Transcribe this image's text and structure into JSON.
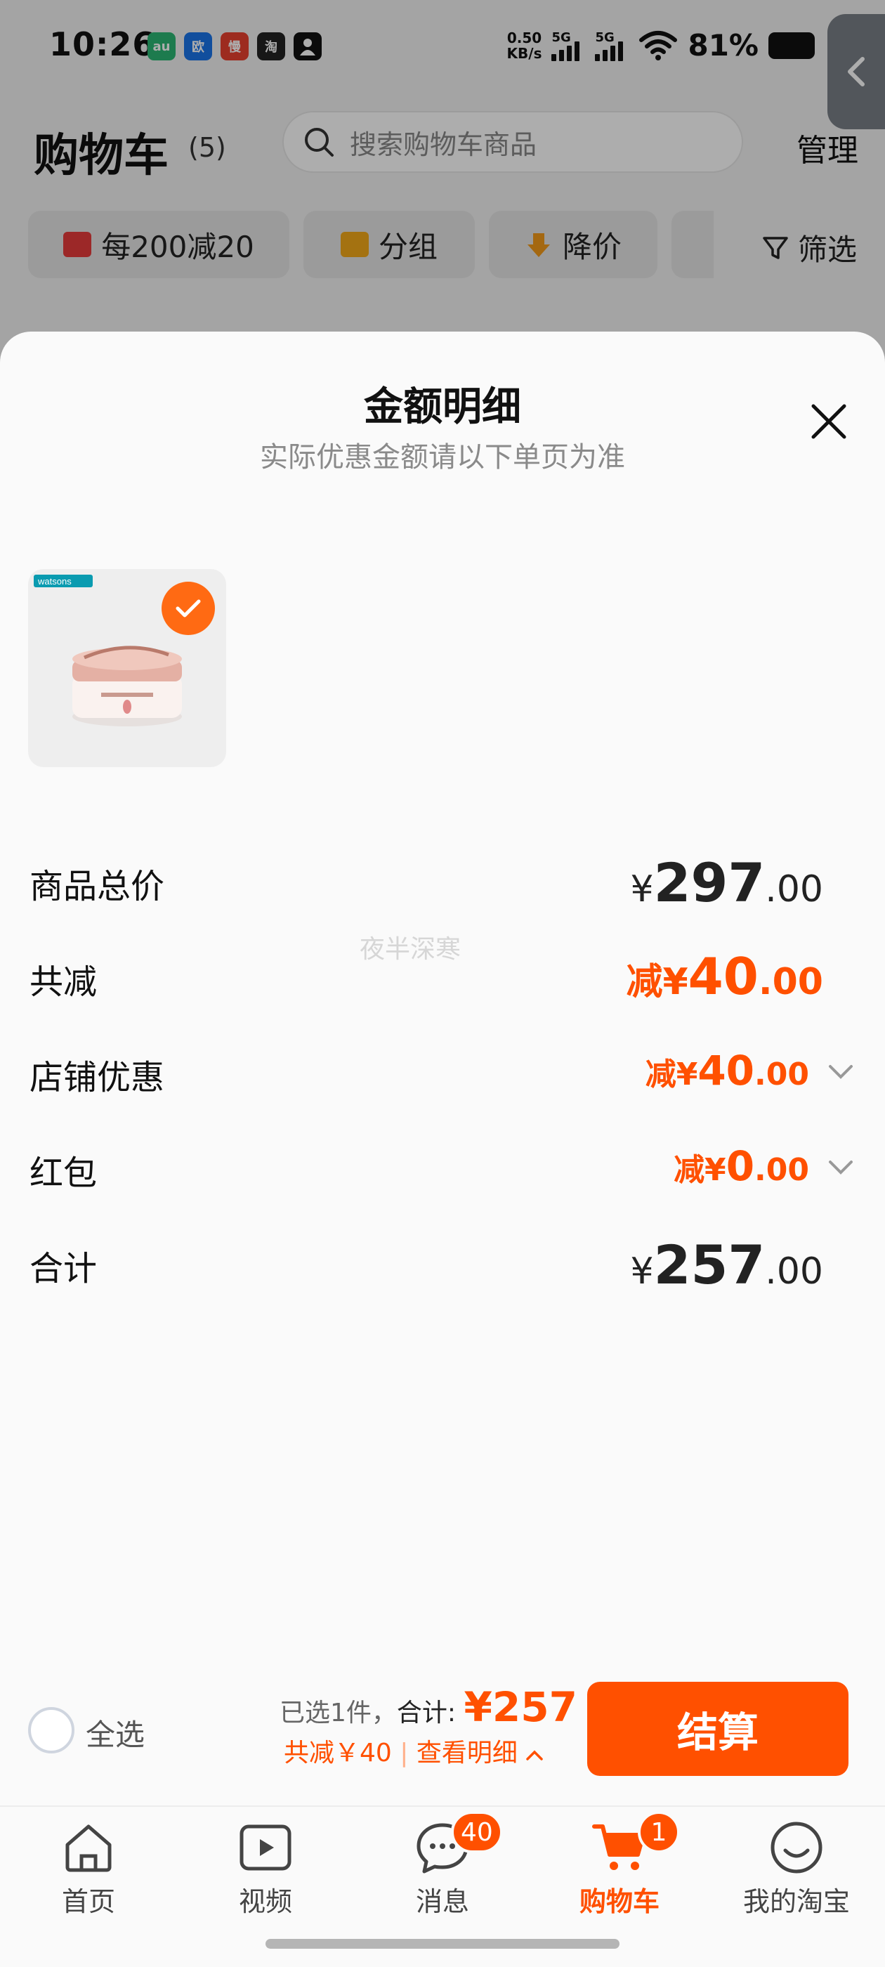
{
  "status_bar": {
    "time": "10:26",
    "net_speed_value": "0.50",
    "net_speed_unit": "KB/s",
    "sig1": "5G",
    "sig2": "5G",
    "battery": "81%",
    "app_icons": [
      "au-app-icon",
      "ouji-app-icon",
      "man-app-icon",
      "taobao-app-icon",
      "person-app-icon"
    ]
  },
  "header": {
    "title": "购物车",
    "count": "(5)",
    "search_placeholder": "搜索购物车商品",
    "manage": "管理"
  },
  "chips": [
    {
      "label": "每200减20",
      "icon": "shop-icon"
    },
    {
      "label": "分组",
      "icon": "folder-icon"
    },
    {
      "label": "降价",
      "icon": "price-down-icon"
    }
  ],
  "filter_label": "筛选",
  "sheet": {
    "title": "金额明细",
    "subtitle": "实际优惠金额请以下单页为准",
    "product_brand": "watsons",
    "rows": [
      {
        "label": "商品总价",
        "prefix": "¥",
        "int": "297",
        "dec": ".00"
      },
      {
        "label": "共减",
        "prefix": "减¥",
        "int": "40",
        "dec": ".00"
      },
      {
        "label": "店铺优惠",
        "prefix": "减¥",
        "int": "40",
        "dec": ".00"
      },
      {
        "label": "红包",
        "prefix": "减¥",
        "int": "0",
        "dec": ".00"
      },
      {
        "label": "合计",
        "prefix": "¥",
        "int": "257",
        "dec": ".00"
      }
    ],
    "watermark": "夜半深寒"
  },
  "checkout": {
    "select_all": "全选",
    "selected": "已选1件，",
    "total_label": "合计:",
    "total_amount": "¥257",
    "discount": "共减￥40",
    "detail_link": "查看明细",
    "pay_button": "结算"
  },
  "tabbar": [
    {
      "label": "首页",
      "icon": "home-icon",
      "badge": ""
    },
    {
      "label": "视频",
      "icon": "video-icon",
      "badge": ""
    },
    {
      "label": "消息",
      "icon": "message-icon",
      "badge": "40"
    },
    {
      "label": "购物车",
      "icon": "cart-icon",
      "badge": "1"
    },
    {
      "label": "我的淘宝",
      "icon": "smile-icon",
      "badge": ""
    }
  ],
  "colors": {
    "accent": "#ff5000",
    "check": "#ff6a13"
  }
}
